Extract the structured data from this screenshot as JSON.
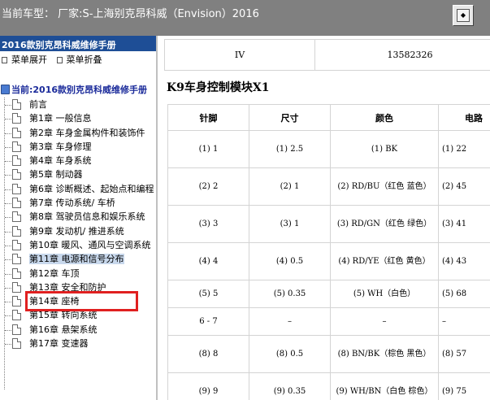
{
  "header": {
    "title": "当前车型：  厂家:S-上海别克昂科威（Envision）2016",
    "toggle_icon": "restore-icon",
    "toggle_glyph": "◆"
  },
  "sidebar": {
    "manual_title": "2016款别克昂科威维修手册",
    "expand_label": "菜单展开",
    "collapse_label": "菜单折叠",
    "tree_root": "当前:2016款别克昂科威维修手册",
    "items": [
      "前言",
      "第1章 一般信息",
      "第2章 车身金属构件和装饰件",
      "第3章 车身修理",
      "第4章 车身系统",
      "第5章 制动器",
      "第6章 诊断概述、起始点和编程",
      "第7章 传动系统/ 车桥",
      "第8章 驾驶员信息和娱乐系统",
      "第9章 发动机/ 推进系统",
      "第10章 暖风、通风与空调系统",
      "第11章 电源和信号分布",
      "第12章 车顶",
      "第13章 安全和防护",
      "第14章 座椅",
      "第15章 转向系统",
      "第16章 悬架系统",
      "第17章 变速器"
    ]
  },
  "content": {
    "top_row": [
      "IV",
      "13582326"
    ],
    "section_title": "K9车身控制模块X1",
    "columns": [
      "针脚",
      "尺寸",
      "颜色",
      "电路"
    ],
    "rows": [
      {
        "pin": "(1) 1",
        "size": "(1) 2.5",
        "color": "(1) BK",
        "circuit": "(1) 22"
      },
      {
        "pin": "(2) 2",
        "size": "(2) 1",
        "color": "(2) RD/BU（红色 蓝色）",
        "circuit": "(2) 45"
      },
      {
        "pin": "(3) 3",
        "size": "(3) 1",
        "color": "(3) RD/GN（红色 绿色）",
        "circuit": "(3) 41"
      },
      {
        "pin": "(4) 4",
        "size": "(4) 0.5",
        "color": "(4) RD/YE（红色 黄色）",
        "circuit": "(4) 43"
      },
      {
        "pin": "(5) 5",
        "size": "(5) 0.35",
        "color": "(5) WH（白色）",
        "circuit": "(5) 68"
      },
      {
        "pin": "6 - 7",
        "size": "–",
        "color": "–",
        "circuit": "–"
      },
      {
        "pin": "(8) 8",
        "size": "(8) 0.5",
        "color": "(8) BN/BK（棕色 黑色）",
        "circuit": "(8) 57"
      },
      {
        "pin": "(9) 9",
        "size": "(9) 0.35",
        "color": "(9) WH/BN（白色 棕色）",
        "circuit": "(9) 75"
      }
    ]
  }
}
